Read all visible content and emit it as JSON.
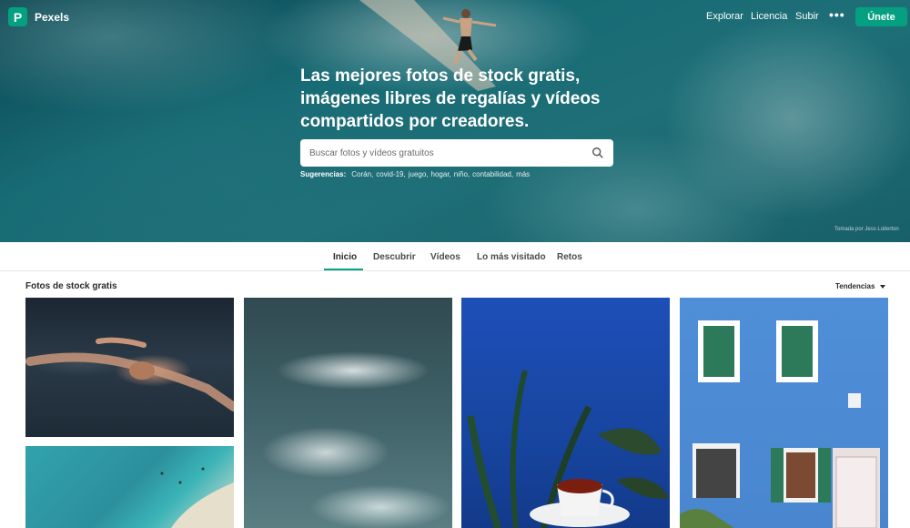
{
  "brand": {
    "name": "Pexels",
    "logo_letter": "P",
    "color": "#05a081"
  },
  "nav": {
    "explore": "Explorar",
    "license": "Licencia",
    "upload": "Subir",
    "more": "•••",
    "join": "Únete"
  },
  "hero": {
    "headline_lines": [
      "Las mejores fotos de stock gratis,",
      "imágenes libres de regalías y vídeos",
      "compartidos por creadores."
    ],
    "search_placeholder": "Buscar fotos y vídeos gratuitos",
    "suggestions_label": "Sugerencias:",
    "suggestions": [
      "Corán,",
      "covid-19,",
      "juego,",
      "hogar,",
      "niño,",
      "contabilidad,",
      "más"
    ],
    "credit": "Tomada por Jess Loiterton"
  },
  "tabs": [
    "Inicio",
    "Descubrir",
    "Vídeos",
    "Lo más visitado",
    "Retos"
  ],
  "active_tab": "Inicio",
  "section": {
    "title": "Fotos de stock gratis",
    "sort_label": "Tendencias"
  },
  "photos": [
    "person swimming in dark water",
    "turquoise beach aerial",
    "white water waves",
    "coffee cup and plant on blue",
    "blue house with green shutters"
  ]
}
